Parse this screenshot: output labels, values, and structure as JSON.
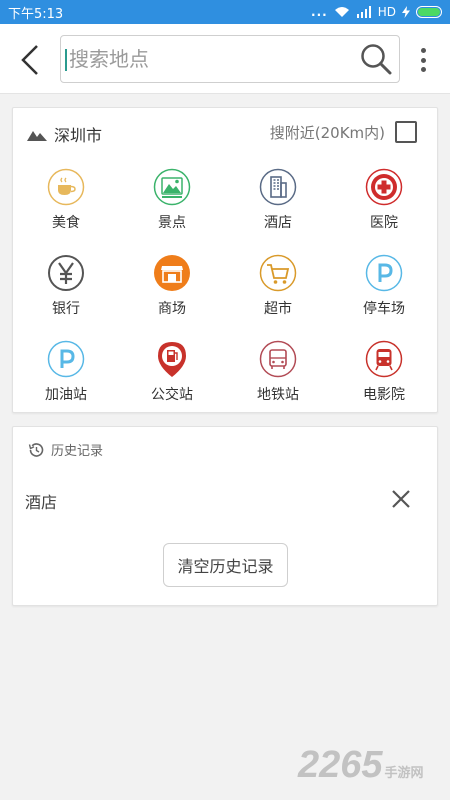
{
  "status_bar": {
    "time": "下午5:13",
    "signal_dots": "...",
    "network": "HD"
  },
  "header": {
    "search_placeholder": "搜索地点"
  },
  "location": {
    "city": "深圳市",
    "nearby_label": "搜附近(20Km内)"
  },
  "categories": [
    {
      "label": "美食",
      "icon": "coffee-cup-icon",
      "color": "#e7b85c"
    },
    {
      "label": "景点",
      "icon": "landscape-icon",
      "color": "#3bb36b"
    },
    {
      "label": "酒店",
      "icon": "building-icon",
      "color": "#5a6b86"
    },
    {
      "label": "医院",
      "icon": "medical-cross-icon",
      "color": "#cf2c2c"
    },
    {
      "label": "银行",
      "icon": "yen-icon",
      "color": "#555555"
    },
    {
      "label": "商场",
      "icon": "store-icon",
      "color": "#ef7d1a"
    },
    {
      "label": "超市",
      "icon": "shopping-cart-icon",
      "color": "#d99a2a"
    },
    {
      "label": "停车场",
      "icon": "parking-icon",
      "color": "#58b8e6"
    },
    {
      "label": "加油站",
      "icon": "parking-icon",
      "color": "#58b8e6"
    },
    {
      "label": "公交站",
      "icon": "gas-pump-pin-icon",
      "color": "#c8322b"
    },
    {
      "label": "地铁站",
      "icon": "bus-icon",
      "color": "#b24b55"
    },
    {
      "label": "电影院",
      "icon": "train-icon",
      "color": "#c8322b"
    }
  ],
  "history": {
    "title": "历史记录",
    "items": [
      {
        "text": "酒店"
      }
    ],
    "clear_label": "清空历史记录"
  },
  "watermark": {
    "number": "2265",
    "text": "手游网"
  }
}
